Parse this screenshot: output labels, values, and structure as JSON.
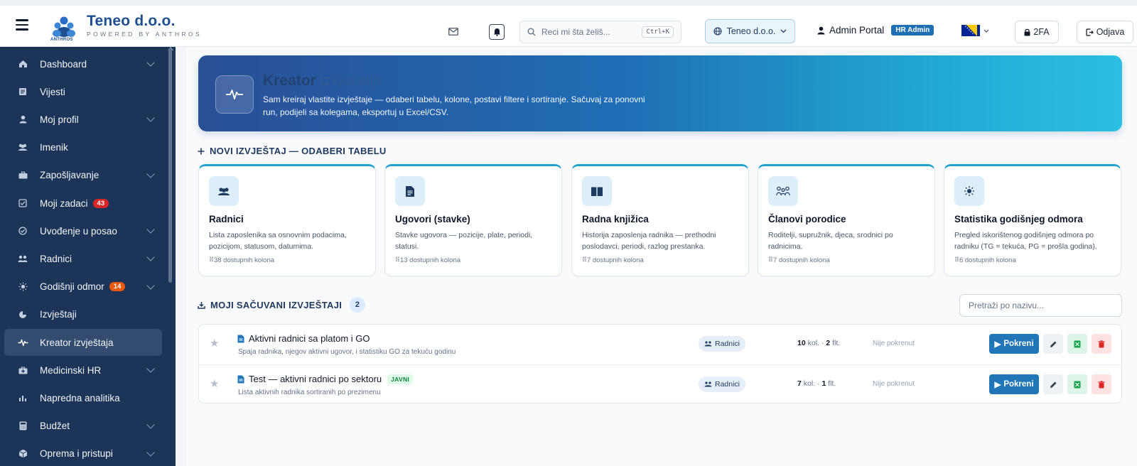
{
  "header": {
    "brand_name": "Teneo d.o.o.",
    "brand_sub": "POWERED BY ANTHROS",
    "logo_caption": "ANTHROS",
    "search_placeholder": "Reci mi šta želiš...",
    "search_shortcut": "Ctrl+K",
    "org_select": "Teneo d.o.o.",
    "portal_label": "Admin Portal",
    "role_badge": "HR Admin",
    "twofa_label": "2FA",
    "logout_label": "Odjava",
    "icons": [
      "hamburger-icon",
      "mail-icon",
      "bell-icon",
      "search-icon",
      "globe-icon",
      "user-icon",
      "flag-icon",
      "lock-icon",
      "logout-icon"
    ]
  },
  "sidebar": {
    "items": [
      {
        "label": "Dashboard",
        "icon": "home-icon",
        "expandable": true
      },
      {
        "label": "Vijesti",
        "icon": "newspaper-icon",
        "expandable": false
      },
      {
        "label": "Moj profil",
        "icon": "user-icon",
        "expandable": true
      },
      {
        "label": "Imenik",
        "icon": "users-icon",
        "expandable": false
      },
      {
        "label": "Zapošljavanje",
        "icon": "briefcase-icon",
        "expandable": true
      },
      {
        "label": "Moji zadaci",
        "icon": "checkbox-icon",
        "expandable": false,
        "badge": "43"
      },
      {
        "label": "Uvođenje u posao",
        "icon": "check-circle-icon",
        "expandable": true
      },
      {
        "label": "Radnici",
        "icon": "team-icon",
        "expandable": true
      },
      {
        "label": "Godišnji odmor",
        "icon": "sun-icon",
        "expandable": true,
        "badge": "14"
      },
      {
        "label": "Izvještaji",
        "icon": "pie-icon",
        "expandable": false
      },
      {
        "label": "Kreator izvještaja",
        "icon": "pulse-icon",
        "expandable": false,
        "active": true
      },
      {
        "label": "Medicinski HR",
        "icon": "medical-kit-icon",
        "expandable": true
      },
      {
        "label": "Napredna analitika",
        "icon": "bar-chart-icon",
        "expandable": false
      },
      {
        "label": "Budžet",
        "icon": "calculator-icon",
        "expandable": true
      },
      {
        "label": "Oprema i pristupi",
        "icon": "box-icon",
        "expandable": true
      }
    ]
  },
  "hero": {
    "title_bold": "Kreator",
    "title_light": "izvještaja",
    "description": "Sam kreiraj vlastite izvještaje — odaberi tabelu, kolone, postavi filtere i sortiranje. Sačuvaj za ponovni run, podijeli sa kolegama, eksportuj u Excel/CSV."
  },
  "new_report": {
    "heading": "NOVI IZVJEŠTAJ — ODABERI TABELU",
    "cards": [
      {
        "title": "Radnici",
        "description": "Lista zaposlenika sa osnovnim podacima, pozicijom, statusom, datumima.",
        "columns": "38 dostupnih kolona",
        "icon": "users-icon"
      },
      {
        "title": "Ugovori (stavke)",
        "description": "Stavke ugovora — pozicije, plate, periodi, statusi.",
        "columns": "13 dostupnih kolona",
        "icon": "document-icon"
      },
      {
        "title": "Radna knjižica",
        "description": "Historija zaposlenja radnika — prethodni poslodavci, periodi, razlog prestanka.",
        "columns": "7 dostupnih kolona",
        "icon": "book-icon"
      },
      {
        "title": "Članovi porodice",
        "description": "Roditelji, supružnik, djeca, srodnici po radnicima.",
        "columns": "7 dostupnih kolona",
        "icon": "family-icon"
      },
      {
        "title": "Statistika godišnjeg odmora",
        "description": "Pregled iskorištenog godišnjeg odmora po radniku (TG = tekuća, PG = prošla godina).",
        "columns": "6 dostupnih kolona",
        "icon": "sun-icon"
      }
    ]
  },
  "saved": {
    "heading": "MOJI SAČUVANI IZVJEŠTAJI",
    "count": "2",
    "filter_placeholder": "Pretraži po nazivu...",
    "rows": [
      {
        "title": "Aktivni radnici sa platom i GO",
        "subtitle": "Spaja radnika, njegov aktivni ugovor, i statistiku GO za tekuću godinu",
        "public_badge": "",
        "table": "Radnici",
        "cols": "10",
        "cols_label": "kol.",
        "filters": "2",
        "filters_label": "flt.",
        "status": "Nije pokrenut",
        "run_label": "Pokreni"
      },
      {
        "title": "Test — aktivni radnici po sektoru",
        "subtitle": "Lista aktivnih radnika sortiranih po prezimenu",
        "public_badge": "JAVNI",
        "table": "Radnici",
        "cols": "7",
        "cols_label": "kol.",
        "filters": "1",
        "filters_label": "flt.",
        "status": "Nije pokrenut",
        "run_label": "Pokreni"
      }
    ]
  },
  "colors": {
    "sidebar_bg": "#1b3457",
    "accent": "#2176b8",
    "hero_gradient_start": "#2a4f95",
    "hero_gradient_end": "#2bc0e2",
    "badge_red": "#dc2626",
    "badge_orange": "#ea580c"
  }
}
